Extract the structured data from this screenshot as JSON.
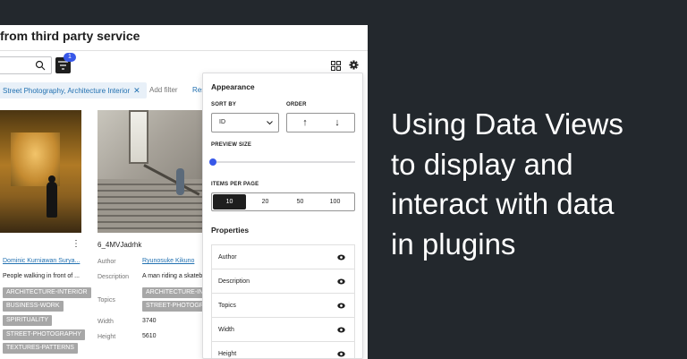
{
  "app": {
    "title": "from third party service",
    "filter_count": "1",
    "active_filter": "Street Photography, Architecture Interior",
    "add_filter": "Add filter",
    "reset": "Res"
  },
  "cards": [
    {
      "title": "",
      "author": "Dominic Kurniawan Surya...",
      "description": "People walking in front of ...",
      "topics": [
        "ARCHITECTURE-INTERIOR",
        "BUSINESS-WORK",
        "SPIRITUALITY",
        "STREET-PHOTOGRAPHY",
        "TEXTURES-PATTERNS"
      ]
    },
    {
      "title": "6_4MVJadrhk",
      "author_label": "Author",
      "author": "Ryunosuke Kikuno",
      "description_label": "Description",
      "description": "A man riding a skateb",
      "topics_label": "Topics",
      "topics": [
        "ARCHITECTURE-INT",
        "STREET-PHOTOGRA"
      ],
      "width_label": "Width",
      "width": "3740",
      "height_label": "Height",
      "height": "5610"
    }
  ],
  "popover": {
    "appearance": "Appearance",
    "sort_by_label": "SORT BY",
    "sort_by_value": "ID",
    "order_label": "ORDER",
    "order_asc": "↑",
    "order_desc": "↓",
    "preview_size_label": "PREVIEW SIZE",
    "preview_size_value": 0,
    "items_per_page_label": "ITEMS PER PAGE",
    "items_per_page": [
      "10",
      "20",
      "50",
      "100"
    ],
    "items_per_page_selected": "10",
    "properties_label": "Properties",
    "properties": [
      "Author",
      "Description",
      "Topics",
      "Width",
      "Height"
    ]
  },
  "headline": {
    "lines": [
      "Using Data Views",
      "to display and",
      "interact with data",
      "in plugins"
    ]
  },
  "colors": {
    "background": "#23282d",
    "accent": "#3858e9",
    "link": "#2271b1"
  }
}
